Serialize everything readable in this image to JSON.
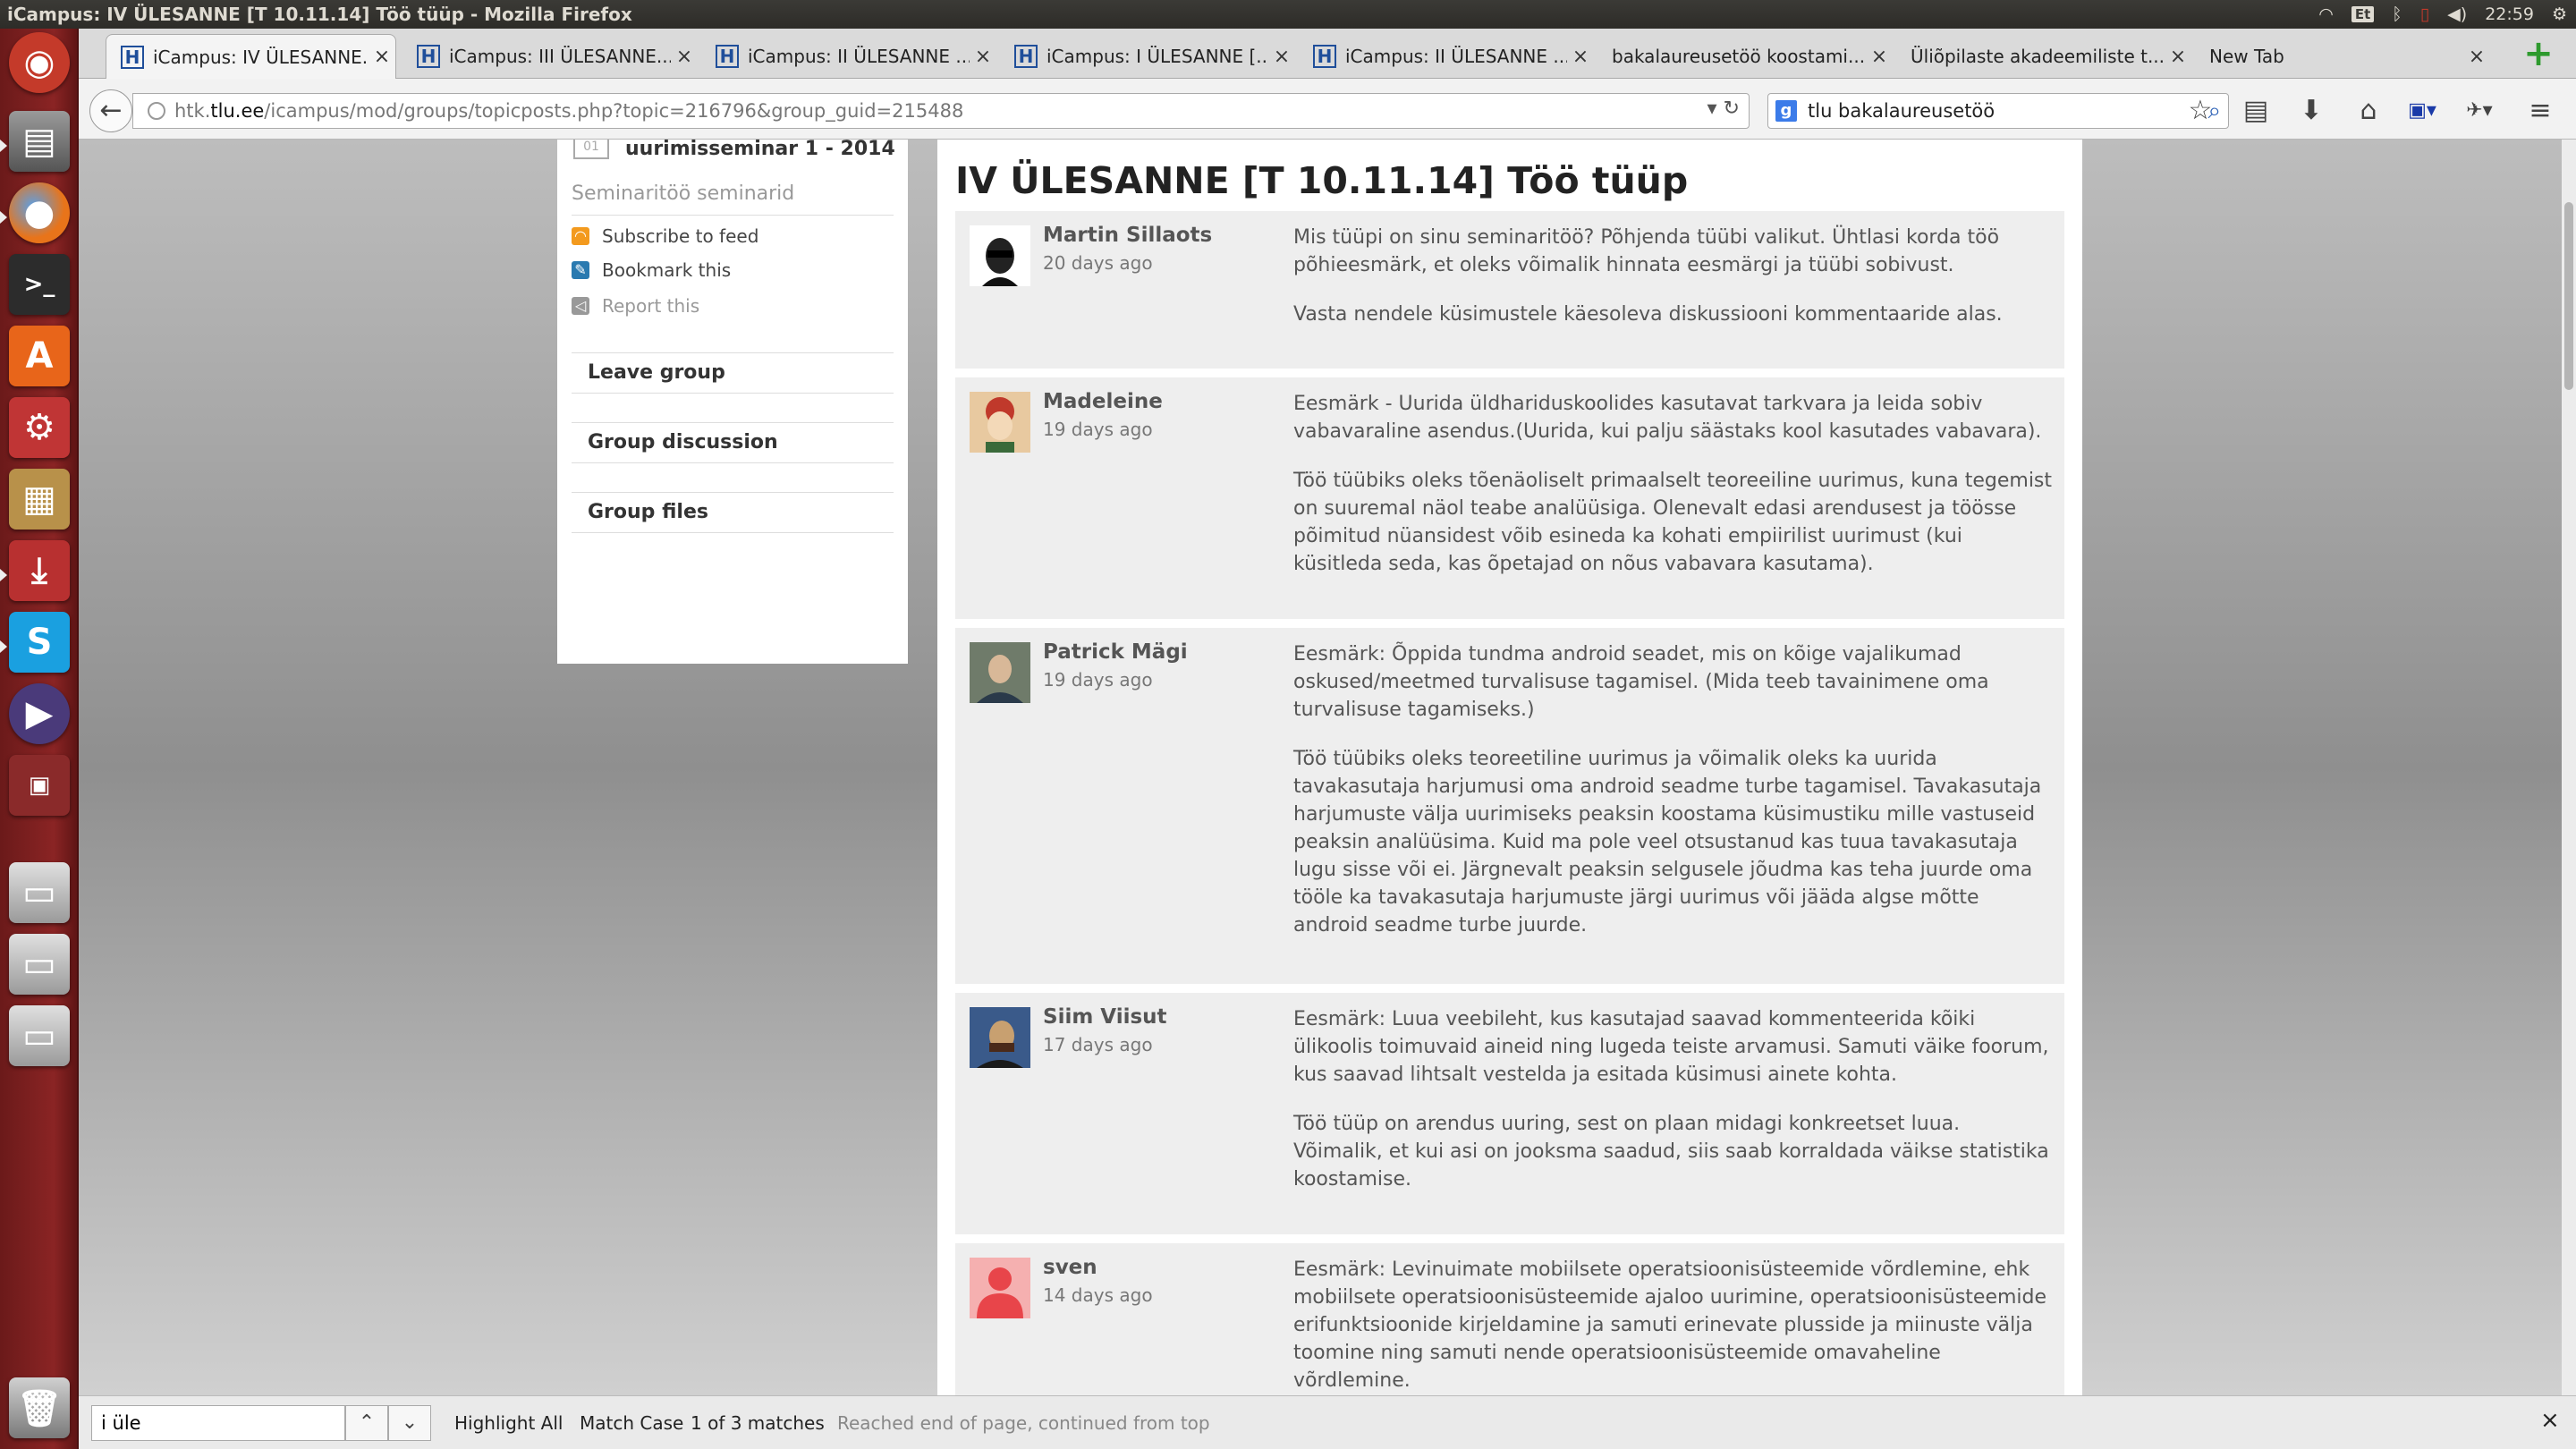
{
  "window": {
    "title": "iCampus: IV ÜLESANNE [T 10.11.14] Töö tüüp - Mozilla Firefox"
  },
  "system_tray": {
    "keyboard": "Et",
    "clock": "22:59"
  },
  "tabs": [
    {
      "label": "iCampus: IV ÜLESANNE...",
      "favicon": "H"
    },
    {
      "label": "iCampus: III ÜLESANNE...",
      "favicon": "H"
    },
    {
      "label": "iCampus: II ÜLESANNE ...",
      "favicon": "H"
    },
    {
      "label": "iCampus: I ÜLESANNE [...",
      "favicon": "H"
    },
    {
      "label": "iCampus: II ÜLESANNE ...",
      "favicon": "H"
    },
    {
      "label": "bakalaureusetöö koostami...",
      "favicon": ""
    },
    {
      "label": "Üliõpilaste akadeemiliste t...",
      "favicon": ""
    },
    {
      "label": "New Tab",
      "favicon": ""
    }
  ],
  "url": {
    "prefix": "htk.",
    "domain": "tlu.ee",
    "path": "/icampus/mod/groups/topicposts.php?topic=216796&group_guid=215488"
  },
  "search": {
    "value": "tlu bakalaureusetöö",
    "engine_icon": "g-icon"
  },
  "sidebar": {
    "group_title": "uurimisseminar 1 - 2014",
    "group_subtitle": "Seminaritöö seminarid",
    "subscribe": "Subscribe to feed",
    "bookmark": "Bookmark this",
    "report": "Report this",
    "leave": "Leave group",
    "discussion": "Group discussion",
    "files": "Group files"
  },
  "topic": {
    "title": "IV ÜLESANNE [T 10.11.14] Töö tüüp"
  },
  "posts": [
    {
      "author": "Martin Sillaots",
      "time": "20 days ago",
      "avatar_color": "#ffffff",
      "paragraphs": [
        "Mis tüüpi on sinu seminaritöö? Põhjenda tüübi valikut. Ühtlasi korda töö põhieesmärk, et oleks võimalik hinnata eesmärgi ja tüübi sobivust.",
        "Vasta nendele küsimustele käesoleva diskussiooni kommentaaride alas."
      ]
    },
    {
      "author": "Madeleine",
      "time": "19 days ago",
      "avatar_color": "#e8c9a0",
      "paragraphs": [
        "Eesmärk - Uurida üldhariduskoolides kasutavat tarkvara ja leida sobiv vabavaraline asendus.(Uurida, kui palju säästaks kool kasutades vabavara).",
        "Töö tüübiks oleks tõenäoliselt primaalselt teoreeiline uurimus, kuna tegemist on suuremal näol teabe analüüsiga. Olenevalt edasi arendusest ja töösse põimitud nüansidest võib esineda ka kohati empiirilist uurimust (kui küsitleda seda, kas õpetajad on nõus vabavara kasutama)."
      ]
    },
    {
      "author": "Patrick Mägi",
      "time": "19 days ago",
      "avatar_color": "#6f7b6a",
      "paragraphs": [
        "Eesmärk: Õppida tundma android seadet, mis on kõige vajalikumad oskused/meetmed turvalisuse tagamisel. (Mida teeb tavainimene oma turvalisuse tagamiseks.)",
        "Töö tüübiks oleks teoreetiline uurimus ja võimalik oleks ka uurida tavakasutaja harjumusi oma android seadme turbe tagamisel. Tavakasutaja harjumuste välja uurimiseks peaksin koostama küsimustiku mille vastuseid peaksin analüüsima. Kuid ma pole veel otsustanud kas tuua tavakasutaja lugu sisse või ei. Järgnevalt peaksin selgusele jõudma kas teha juurde oma tööle ka tavakasutaja harjumuste järgi uurimus või jääda algse mõtte android seadme turbe juurde."
      ]
    },
    {
      "author": "Siim Viisut",
      "time": "17 days ago",
      "avatar_color": "#3a5a8a",
      "paragraphs": [
        "Eesmärk: Luua veebileht, kus kasutajad saavad kommenteerida kõiki ülikoolis toimuvaid aineid ning lugeda teiste arvamusi. Samuti väike foorum, kus saavad lihtsalt vestelda ja esitada küsimusi ainete kohta.",
        "Töö tüüp on arendus uuring, sest on plaan midagi konkreetset luua. Võimalik, et kui asi on jooksma saadud, siis saab korraldada väikse statistika koostamise."
      ]
    },
    {
      "author": "sven",
      "time": "14 days ago",
      "avatar_color": "#e8454a",
      "paragraphs": [
        "Eesmärk: Levinuimate mobiilsete operatsioonisüsteemide võrdlemine, ehk mobiilsete operatsioonisüsteemide ajaloo uurimine, operatsioonisüsteemide erifunktsioonide kirjeldamine ja samuti erinevate plusside ja miinuste välja toomine ning samuti nende operatsioonisüsteemide omavaheline võrdlemine."
      ]
    }
  ],
  "findbar": {
    "value": "i üle",
    "highlight_all": "Highlight All",
    "match_case": "Match Case",
    "matches": "1 of 3 matches",
    "status": "Reached end of page, continued from top"
  }
}
